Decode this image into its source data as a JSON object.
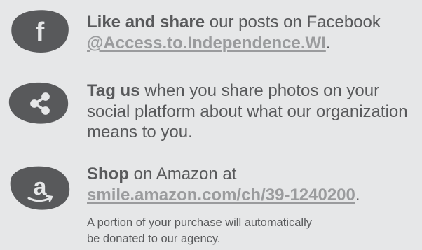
{
  "facebook": {
    "icon": "facebook-icon",
    "lead": "Like and share",
    "rest": " our posts on Facebook",
    "handle": "@Access.to.Independence.WI",
    "punct": "."
  },
  "tag": {
    "icon": "share-icon",
    "lead": "Tag us",
    "rest": " when you share photos on your social platform about what our organization means to you."
  },
  "amazon": {
    "icon": "amazon-icon",
    "lead": "Shop",
    "rest": " on Amazon at",
    "link": "smile.amazon.com/ch/39-1240200",
    "punct": ".",
    "note": "A portion of your purchase will automatically be donated to our agency."
  },
  "colors": {
    "background": "#e6e7e8",
    "text": "#58595b",
    "link": "#9a9b9d",
    "blob": "#58595b"
  }
}
